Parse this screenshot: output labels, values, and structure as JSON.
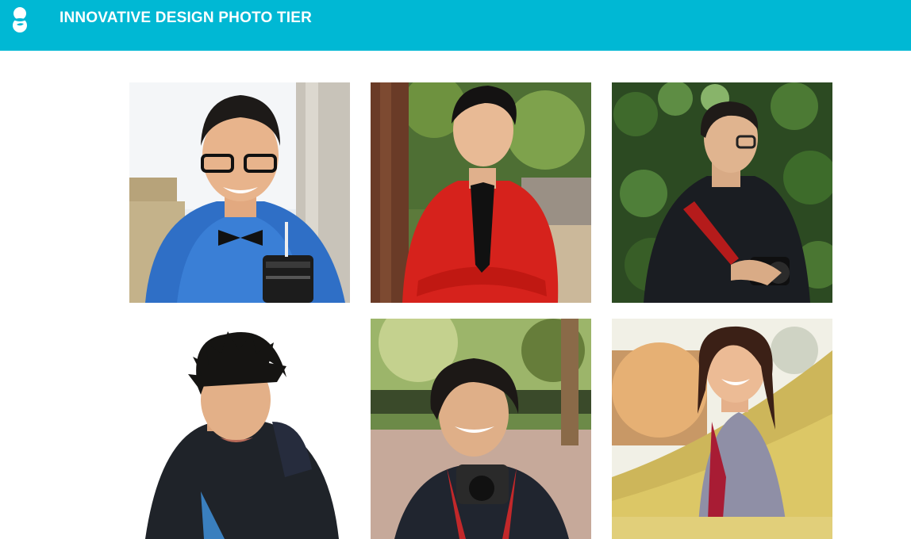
{
  "header": {
    "title": "INNOVATIVE DESIGN PHOTO TIER",
    "logo_icon": "ninja-logo-icon",
    "background_color": "#00b8d4"
  },
  "gallery": {
    "photos": [
      {
        "subject": "portrait-man-blue-shirt-bowtie-glasses-lens-mug"
      },
      {
        "subject": "portrait-man-red-shirt-black-tie-arms-crossed"
      },
      {
        "subject": "portrait-man-black-jacket-camera-ivy-wall"
      },
      {
        "subject": "portrait-man-dark-jacket-white-background"
      },
      {
        "subject": "portrait-person-camera-strap-park"
      },
      {
        "subject": "portrait-woman-grass-field-sunset"
      }
    ]
  }
}
